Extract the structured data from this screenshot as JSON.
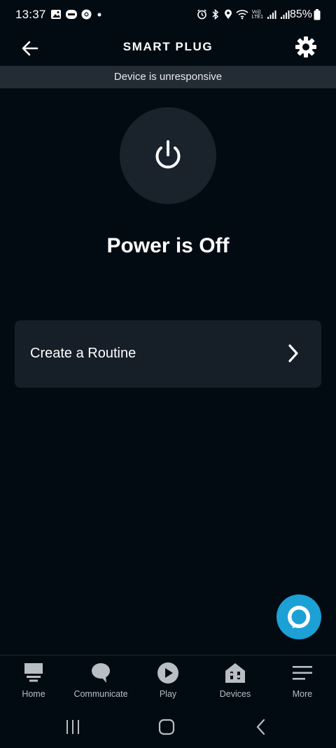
{
  "status_bar": {
    "time": "13:37",
    "battery": "85%",
    "network_label_top": "Vo))",
    "network_label_bottom": "LTE1"
  },
  "header": {
    "title": "SMART PLUG"
  },
  "banner": {
    "text": "Device is unresponsive"
  },
  "device": {
    "power_status": "Power is Off"
  },
  "routine": {
    "label": "Create a Routine"
  },
  "bottom_nav": {
    "items": [
      {
        "label": "Home",
        "icon": "home-icon"
      },
      {
        "label": "Communicate",
        "icon": "chat-bubble-icon"
      },
      {
        "label": "Play",
        "icon": "play-icon"
      },
      {
        "label": "Devices",
        "icon": "devices-icon"
      },
      {
        "label": "More",
        "icon": "menu-icon"
      }
    ]
  },
  "colors": {
    "background": "#030b12",
    "banner": "#232c35",
    "card": "#161e27",
    "power_button": "#1a232c",
    "alexa_accent": "#1ca0d6"
  }
}
